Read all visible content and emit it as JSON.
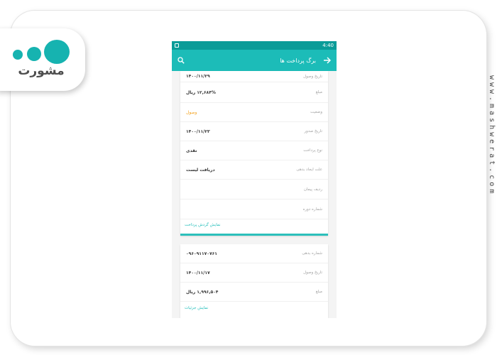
{
  "brand": {
    "logo_text": "مشورت",
    "watermark": "www.mashwerat.com",
    "accent": "#1cbcb8"
  },
  "status_bar": {
    "time": "4:40"
  },
  "app_bar": {
    "title": "برگ پرداخت ها",
    "back_icon": "arrow-right-icon",
    "search_icon": "search-icon"
  },
  "card1": {
    "rows": [
      {
        "label": "تاریخ وصول",
        "value": "۱۴۰۰/۱۱/۲۹"
      },
      {
        "label": "مبلغ",
        "value": "۱۲,۶۸۴% ریال"
      },
      {
        "label": "وضعیت",
        "value": "وصول"
      },
      {
        "label": "تاریخ صدور",
        "value": "۱۴۰۰/۱۱/۲۳"
      },
      {
        "label": "نوع پرداخت",
        "value": "نقدی"
      },
      {
        "label": "علت ایجاد بدهی",
        "value": "دریافت لیست"
      },
      {
        "label": "ردیف پیمان",
        "value": ""
      },
      {
        "label": "شماره دوره",
        "value": ""
      }
    ],
    "link": "نمایش گردش پرداخت"
  },
  "card2": {
    "rows": [
      {
        "label": "شماره بدهی",
        "value": "۰۹۶۰۹۱۱۷۰۷۶۱"
      },
      {
        "label": "تاریخ وصول",
        "value": "۱۴۰۰/۱۱/۱۷"
      },
      {
        "label": "مبلغ",
        "value": "۱,۹۹۶,۵۰۴ ریال"
      }
    ],
    "link": "نمایش جزئیات"
  }
}
